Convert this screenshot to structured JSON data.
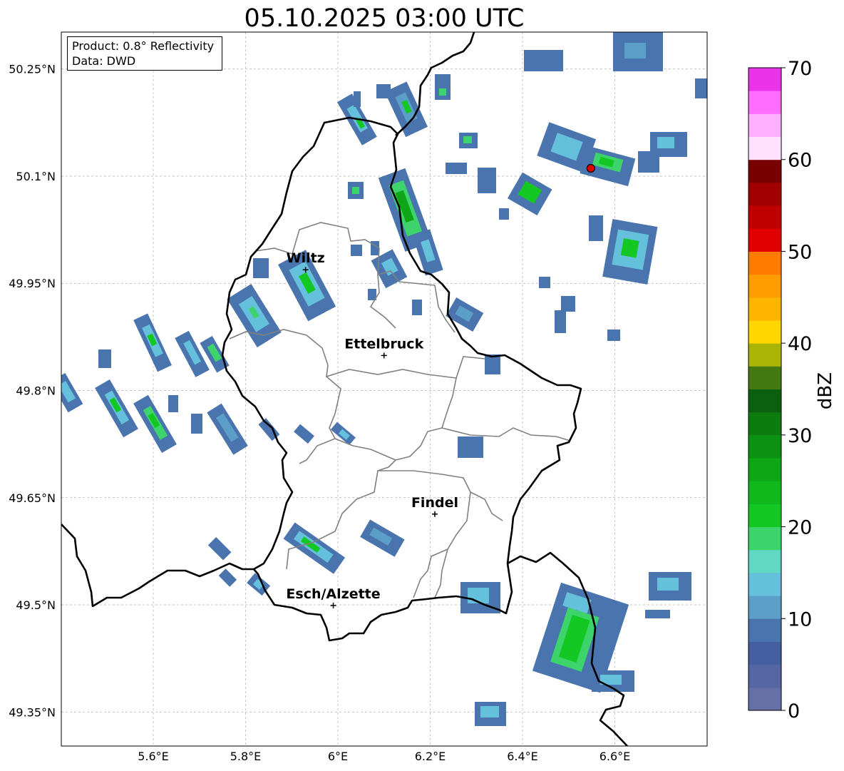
{
  "title": "05.10.2025 03:00 UTC",
  "info": {
    "product": "Product: 0.8° Reflectivity",
    "data": "Data: DWD"
  },
  "axes": {
    "lon_range": [
      5.4,
      6.8
    ],
    "lat_range": [
      49.3,
      50.3
    ],
    "lon_ticks": [
      {
        "value": 5.6,
        "label": "5.6°E"
      },
      {
        "value": 5.8,
        "label": "5.8°E"
      },
      {
        "value": 6.0,
        "label": "6°E"
      },
      {
        "value": 6.2,
        "label": "6.2°E"
      },
      {
        "value": 6.4,
        "label": "6.4°E"
      },
      {
        "value": 6.6,
        "label": "6.6°E"
      }
    ],
    "lat_ticks": [
      {
        "value": 50.25,
        "label": "50.25°N"
      },
      {
        "value": 50.1,
        "label": "50.1°N"
      },
      {
        "value": 49.95,
        "label": "49.95°N"
      },
      {
        "value": 49.8,
        "label": "49.8°N"
      },
      {
        "value": 49.65,
        "label": "49.65°N"
      },
      {
        "value": 49.5,
        "label": "49.5°N"
      },
      {
        "value": 49.35,
        "label": "49.35°N"
      }
    ]
  },
  "cities": [
    {
      "name": "Wiltz",
      "lon": 5.93,
      "lat": 49.969
    },
    {
      "name": "Ettelbruck",
      "lon": 6.1,
      "lat": 49.849
    },
    {
      "name": "Findel",
      "lon": 6.21,
      "lat": 49.627
    },
    {
      "name": "Esch/Alzette",
      "lon": 5.99,
      "lat": 49.499
    }
  ],
  "radar_site": {
    "lon": 6.548,
    "lat": 50.111,
    "color": "#e00000"
  },
  "colorbar": {
    "label": "dBZ",
    "min": 0,
    "max": 70,
    "ticks": [
      {
        "value": 0,
        "label": "0"
      },
      {
        "value": 10,
        "label": "10"
      },
      {
        "value": 20,
        "label": "20"
      },
      {
        "value": 30,
        "label": "30"
      },
      {
        "value": 40,
        "label": "40"
      },
      {
        "value": 50,
        "label": "50"
      },
      {
        "value": 60,
        "label": "60"
      },
      {
        "value": 70,
        "label": "70"
      }
    ],
    "colors": [
      "#6470a6",
      "#5566a2",
      "#445ea0",
      "#4a74ae",
      "#5b9ec8",
      "#65c0dc",
      "#5fd8c4",
      "#3ed46c",
      "#14c824",
      "#10b81c",
      "#0ea616",
      "#0c9212",
      "#0c7c10",
      "#0a600e",
      "#447810",
      "#aab404",
      "#ffd600",
      "#ffb400",
      "#ff9c00",
      "#ff7c00",
      "#e00000",
      "#c00000",
      "#a00000",
      "#780000",
      "#ffe0ff",
      "#ffb0ff",
      "#ff6eff",
      "#ea34ea"
    ]
  }
}
